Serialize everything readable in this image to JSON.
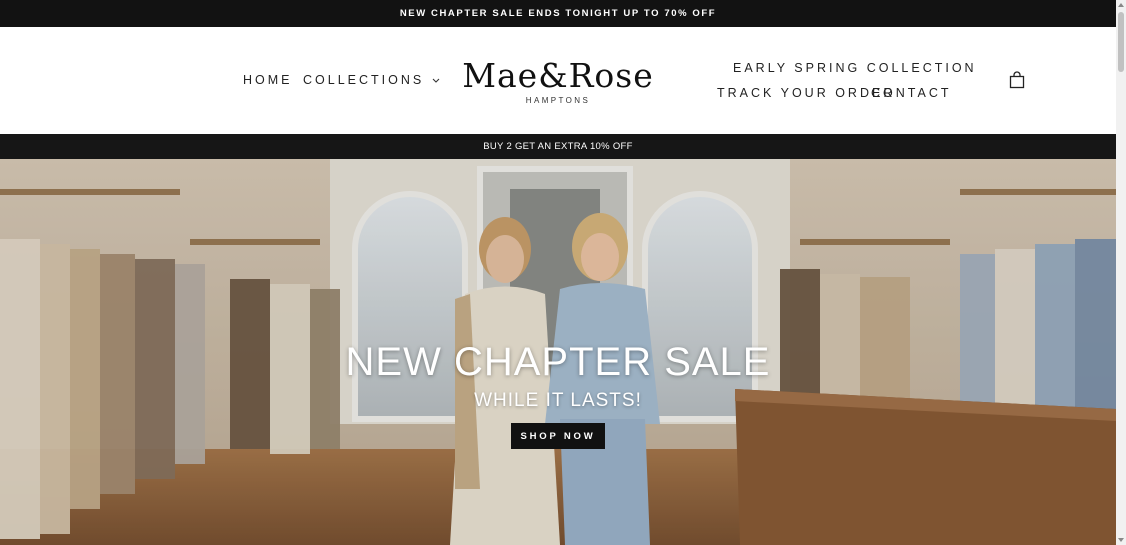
{
  "announcement": {
    "text": "NEW CHAPTER SALE ENDS TONIGHT UP TO 70% OFF"
  },
  "nav": {
    "home": "HOME",
    "collections": "COLLECTIONS",
    "early_spring": "EARLY SPRING COLLECTION",
    "track_order": "TRACK YOUR ORDER",
    "contact": "CONTACT"
  },
  "logo": {
    "main": "Mae&Rose",
    "sub": "HAMPTONS"
  },
  "icons": {
    "cart": "shopping-bag-icon",
    "dropdown": "chevron-down-icon"
  },
  "promo": {
    "text": "BUY 2 GET AN EXTRA 10% OFF"
  },
  "hero": {
    "title": "NEW CHAPTER SALE",
    "subtitle": "WHILE IT LASTS!",
    "button": "SHOP NOW"
  },
  "colors": {
    "bar_bg": "#121212",
    "button_bg": "#111111",
    "text": "#222222"
  }
}
